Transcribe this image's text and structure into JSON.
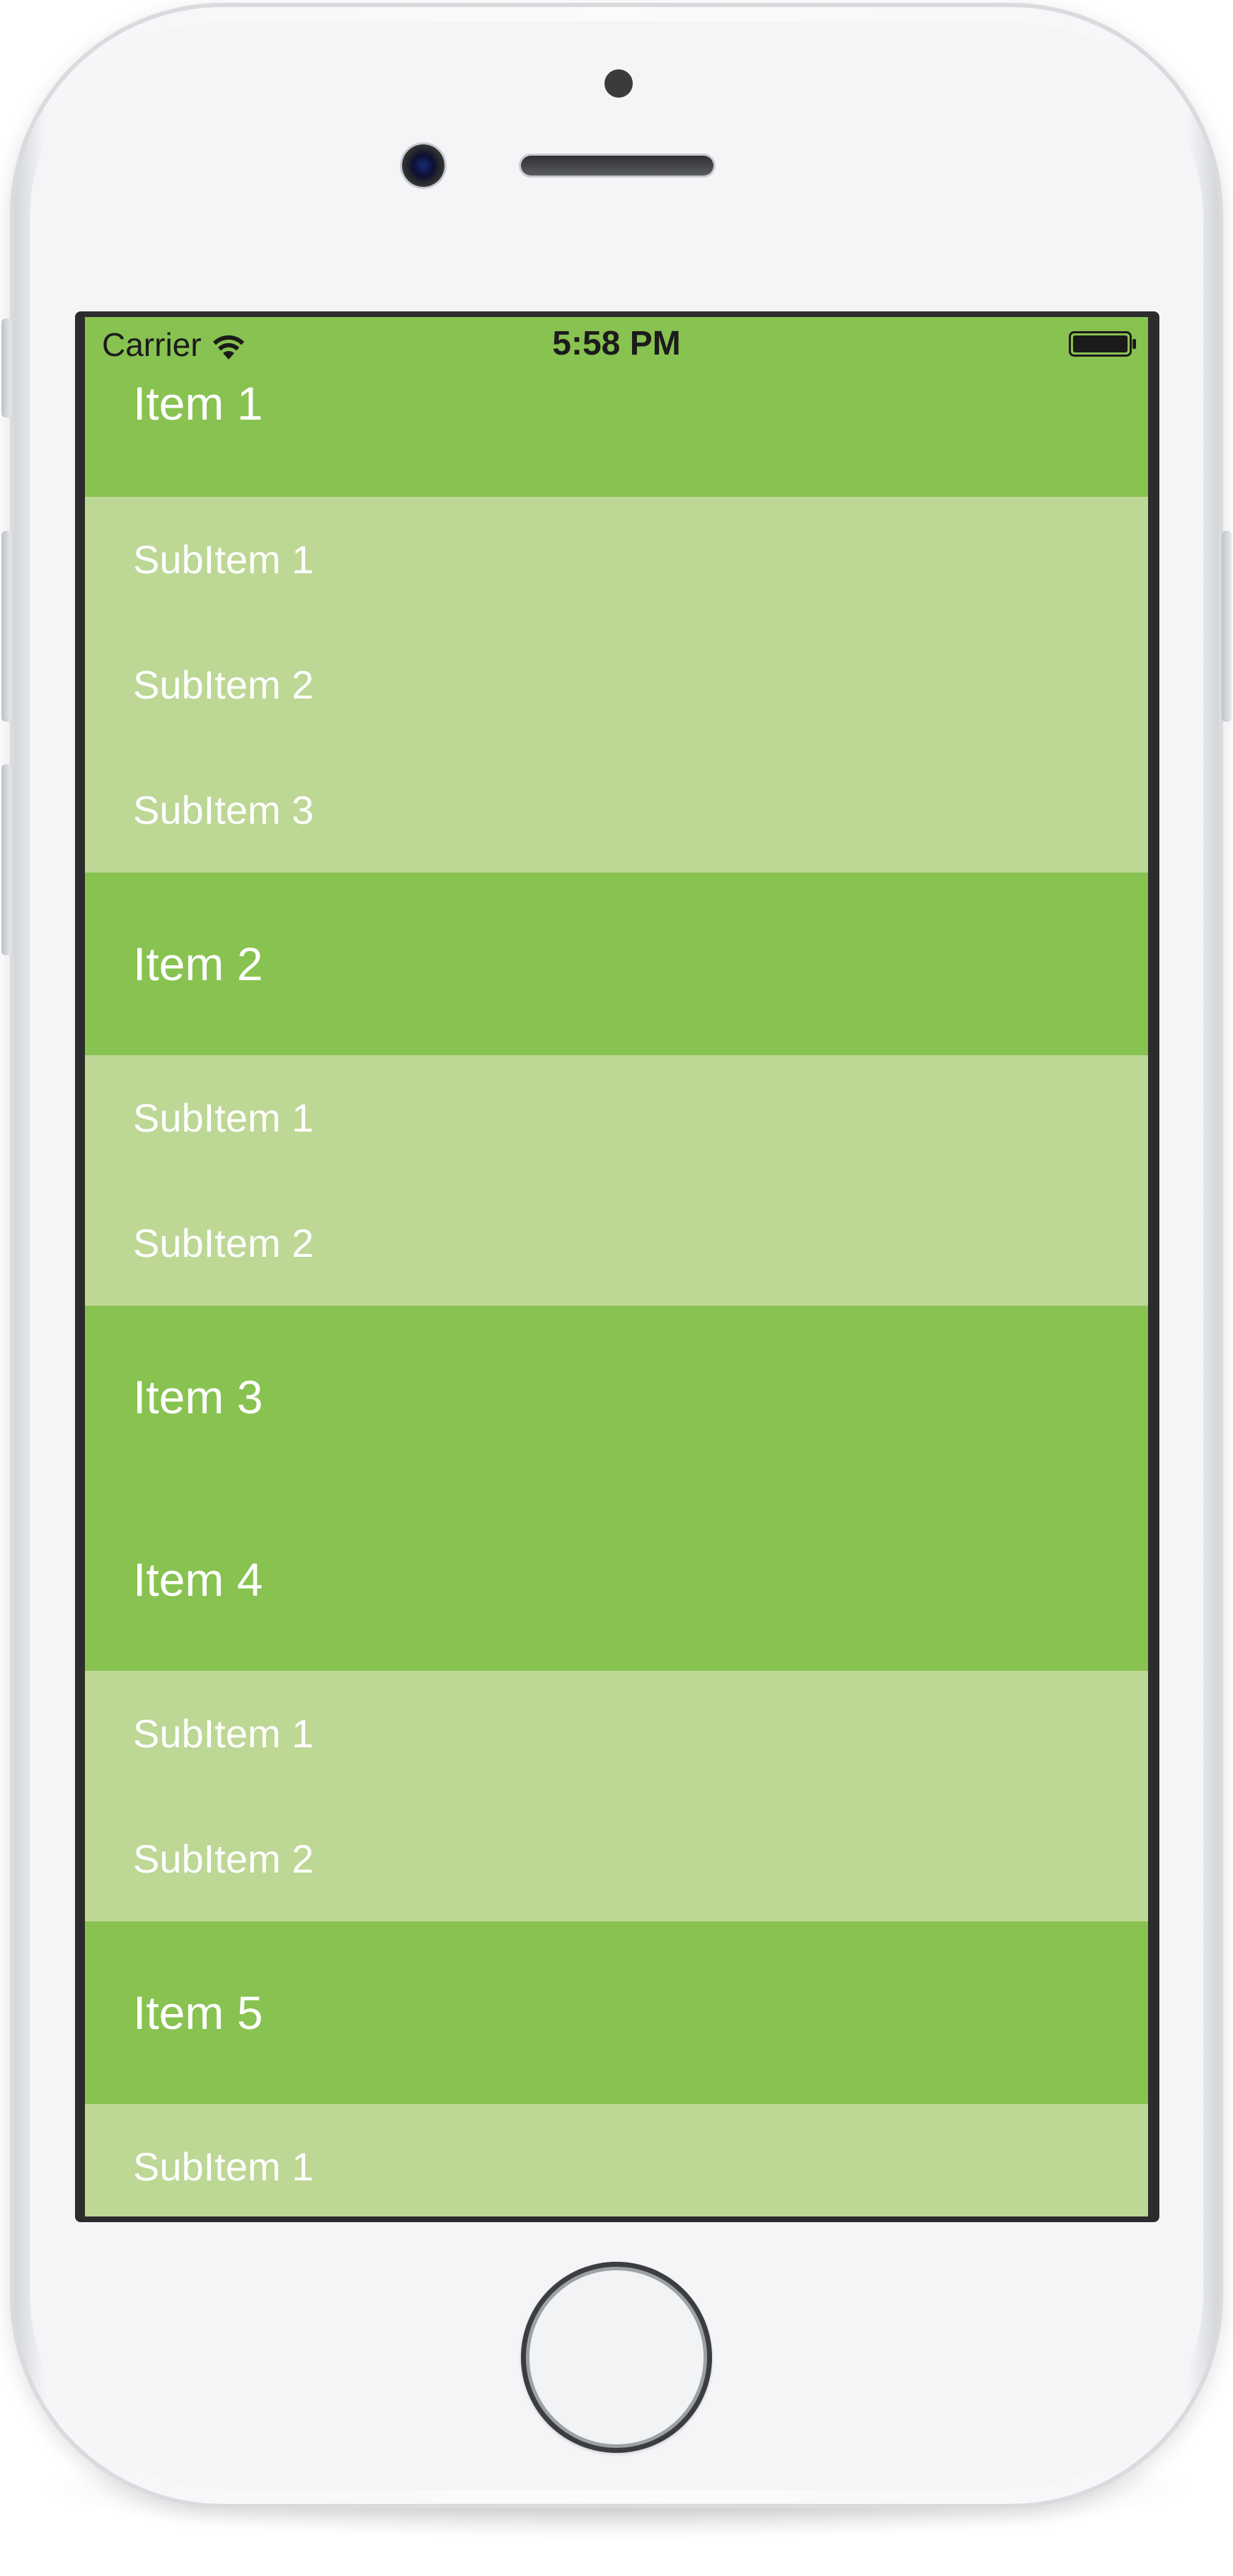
{
  "status_bar": {
    "carrier": "Carrier",
    "time": "5:58 PM",
    "wifi_icon": "wifi-icon",
    "battery_icon": "battery-icon"
  },
  "colors": {
    "item_background": "#88c250",
    "subitem_background": "#bdd795",
    "text": "#ffffff"
  },
  "list": {
    "rows": [
      {
        "type": "item",
        "label": "Item 1"
      },
      {
        "type": "sub",
        "label": "SubItem 1"
      },
      {
        "type": "sub",
        "label": "SubItem 2"
      },
      {
        "type": "sub",
        "label": "SubItem 3"
      },
      {
        "type": "item",
        "label": "Item 2"
      },
      {
        "type": "sub",
        "label": "SubItem 1"
      },
      {
        "type": "sub",
        "label": "SubItem 2"
      },
      {
        "type": "item",
        "label": "Item 3"
      },
      {
        "type": "item",
        "label": "Item 4"
      },
      {
        "type": "sub",
        "label": "SubItem 1"
      },
      {
        "type": "sub",
        "label": "SubItem 2"
      },
      {
        "type": "item",
        "label": "Item 5"
      },
      {
        "type": "sub",
        "label": "SubItem 1"
      }
    ]
  }
}
